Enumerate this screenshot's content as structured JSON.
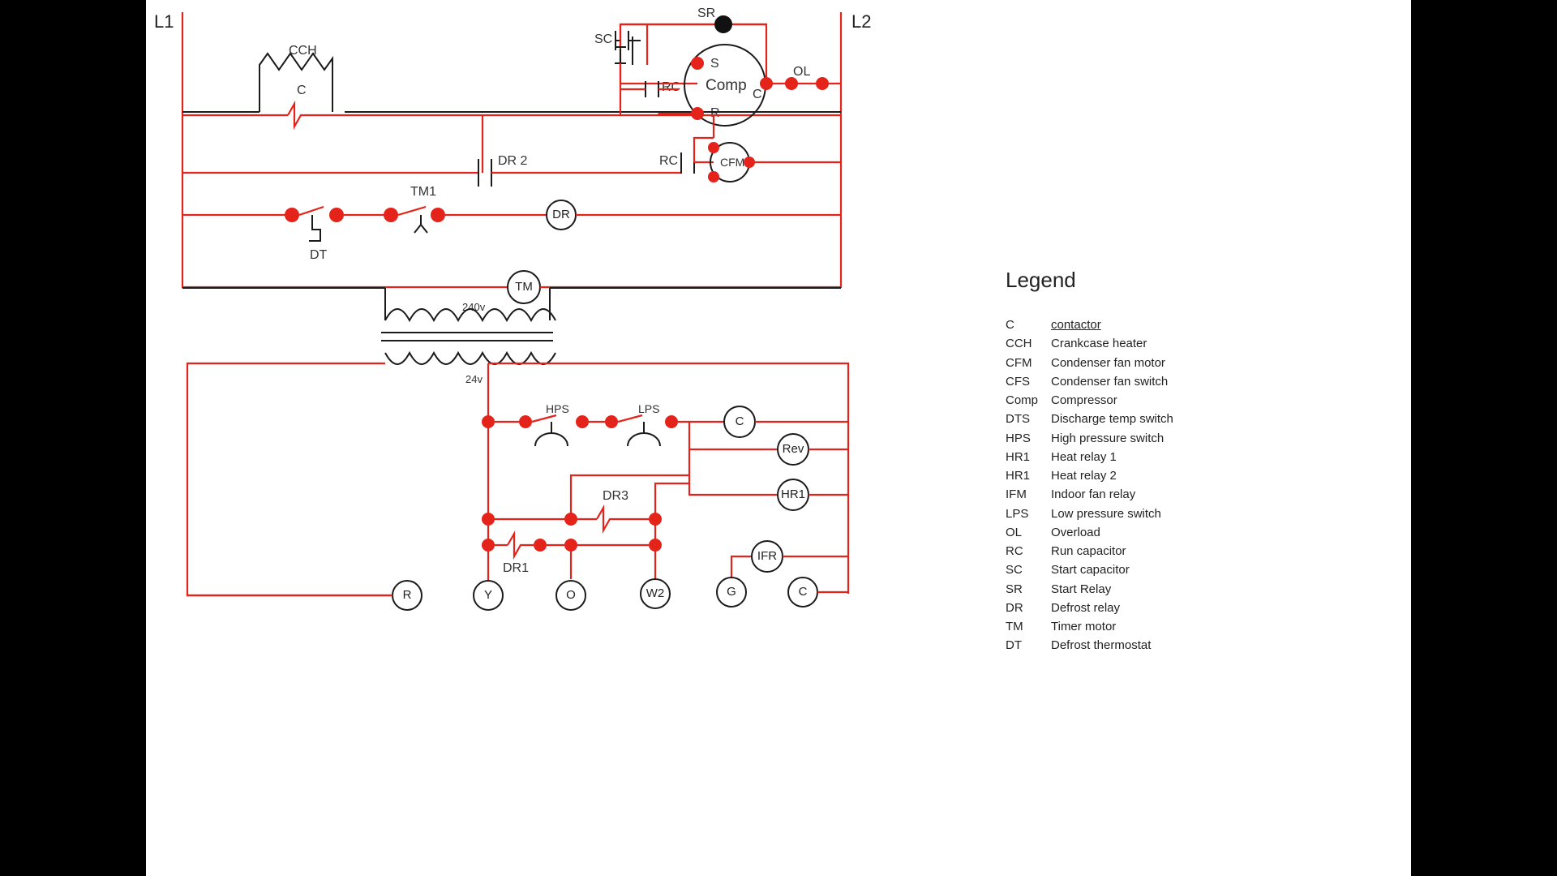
{
  "rails": {
    "l1": "L1",
    "l2": "L2"
  },
  "labels": {
    "cch": "CCH",
    "c": "C",
    "sc": "SC",
    "sr": "SR",
    "rc1": "RC",
    "rc2": "RC",
    "s": "S",
    "cterm": "C",
    "r": "R",
    "comp": "Comp",
    "ol": "OL",
    "cfm": "CFM",
    "dr2": "DR 2",
    "dt": "DT",
    "tm1": "TM1",
    "dr": "DR",
    "tm": "TM",
    "v240": "240v",
    "v24": "24v",
    "hps": "HPS",
    "lps": "LPS",
    "ccoil": "C",
    "rev": "Rev",
    "hr1": "HR1",
    "dr3": "DR3",
    "dr1": "DR1",
    "ifr": "IFR",
    "rterm": "R",
    "yterm": "Y",
    "oterm": "O",
    "w2term": "W2",
    "gterm": "G",
    "cterm2": "C"
  },
  "legend_title": "Legend",
  "legend": [
    {
      "k": "C",
      "v": "contactor"
    },
    {
      "k": "CCH",
      "v": "Crankcase heater"
    },
    {
      "k": "CFM",
      "v": "Condenser fan motor"
    },
    {
      "k": "CFS",
      "v": "Condenser fan switch"
    },
    {
      "k": "Comp",
      "v": "Compressor"
    },
    {
      "k": "DTS",
      "v": "Discharge temp switch"
    },
    {
      "k": "HPS",
      "v": "High pressure switch"
    },
    {
      "k": "HR1",
      "v": "Heat relay 1"
    },
    {
      "k": "HR1",
      "v": "Heat relay 2"
    },
    {
      "k": "IFM",
      "v": "Indoor fan relay"
    },
    {
      "k": "LPS",
      "v": "Low pressure switch"
    },
    {
      "k": "OL",
      "v": "Overload"
    },
    {
      "k": "RC",
      "v": "Run capacitor"
    },
    {
      "k": "SC",
      "v": "Start capacitor"
    },
    {
      "k": "SR",
      "v": "Start Relay"
    },
    {
      "k": "DR",
      "v": "Defrost relay"
    },
    {
      "k": "TM",
      "v": "Timer motor"
    },
    {
      "k": "DT",
      "v": "Defrost thermostat"
    }
  ]
}
